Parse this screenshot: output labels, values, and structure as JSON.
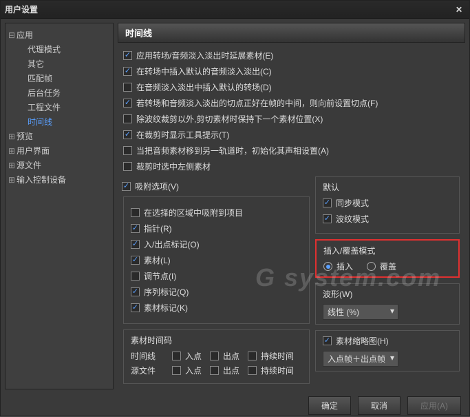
{
  "window": {
    "title": "用户设置"
  },
  "tree": {
    "items": [
      {
        "label": "应用",
        "exp": "⊟"
      },
      {
        "label": "代理模式"
      },
      {
        "label": "其它"
      },
      {
        "label": "匹配帧"
      },
      {
        "label": "后台任务"
      },
      {
        "label": "工程文件"
      },
      {
        "label": "时间线",
        "selected": true
      },
      {
        "label": "预览",
        "exp": "⊞"
      },
      {
        "label": "用户界面",
        "exp": "⊞"
      },
      {
        "label": "源文件",
        "exp": "⊞"
      },
      {
        "label": "输入控制设备",
        "exp": "⊞"
      }
    ]
  },
  "section": {
    "title": "时间线"
  },
  "checks": [
    {
      "label": "应用转场/音频淡入淡出时延展素材(E)",
      "on": true
    },
    {
      "label": "在转场中插入默认的音频淡入淡出(C)",
      "on": true
    },
    {
      "label": "在音频淡入淡出中插入默认的转场(D)",
      "on": false
    },
    {
      "label": "若转场和音频淡入淡出的切点正好在帧的中间，则向前设置切点(F)",
      "on": true
    },
    {
      "label": "除波纹裁剪以外,剪切素材时保持下一个素材位置(X)",
      "on": false
    },
    {
      "label": "在裁剪时显示工具提示(T)",
      "on": true
    },
    {
      "label": "当把音频素材移到另一轨道时，初始化其声相设置(A)",
      "on": false
    },
    {
      "label": "裁剪时选中左侧素材",
      "on": false
    }
  ],
  "snap": {
    "title": "吸附选项(V)",
    "on": true,
    "items": [
      {
        "label": "在选择的区域中吸附到项目",
        "on": false
      },
      {
        "label": "指针(R)",
        "on": true
      },
      {
        "label": "入/出点标记(O)",
        "on": true
      },
      {
        "label": "素材(L)",
        "on": true
      },
      {
        "label": "调节点(I)",
        "on": false
      },
      {
        "label": "序列标记(Q)",
        "on": true
      },
      {
        "label": "素材标记(K)",
        "on": true
      }
    ]
  },
  "defaults": {
    "title": "默认",
    "items": [
      {
        "label": "同步模式",
        "on": true
      },
      {
        "label": "波纹模式",
        "on": true
      }
    ]
  },
  "mode": {
    "title": "插入/覆盖模式",
    "options": [
      {
        "label": "插入",
        "on": true
      },
      {
        "label": "覆盖",
        "on": false
      }
    ]
  },
  "waveform": {
    "title": "波形(W)",
    "value": "线性 (%)"
  },
  "thumb": {
    "title": "素材缩略图(H)",
    "on": true,
    "value": "入点帧＋出点帧"
  },
  "timecode": {
    "title": "素材时间码",
    "rows": [
      {
        "label": "时间线",
        "cols": [
          "入点",
          "出点",
          "持续时间"
        ]
      },
      {
        "label": "源文件",
        "cols": [
          "入点",
          "出点",
          "持续时间"
        ]
      }
    ]
  },
  "footer": {
    "ok": "确定",
    "cancel": "取消",
    "apply": "应用(A)"
  },
  "watermark": "G system.com"
}
